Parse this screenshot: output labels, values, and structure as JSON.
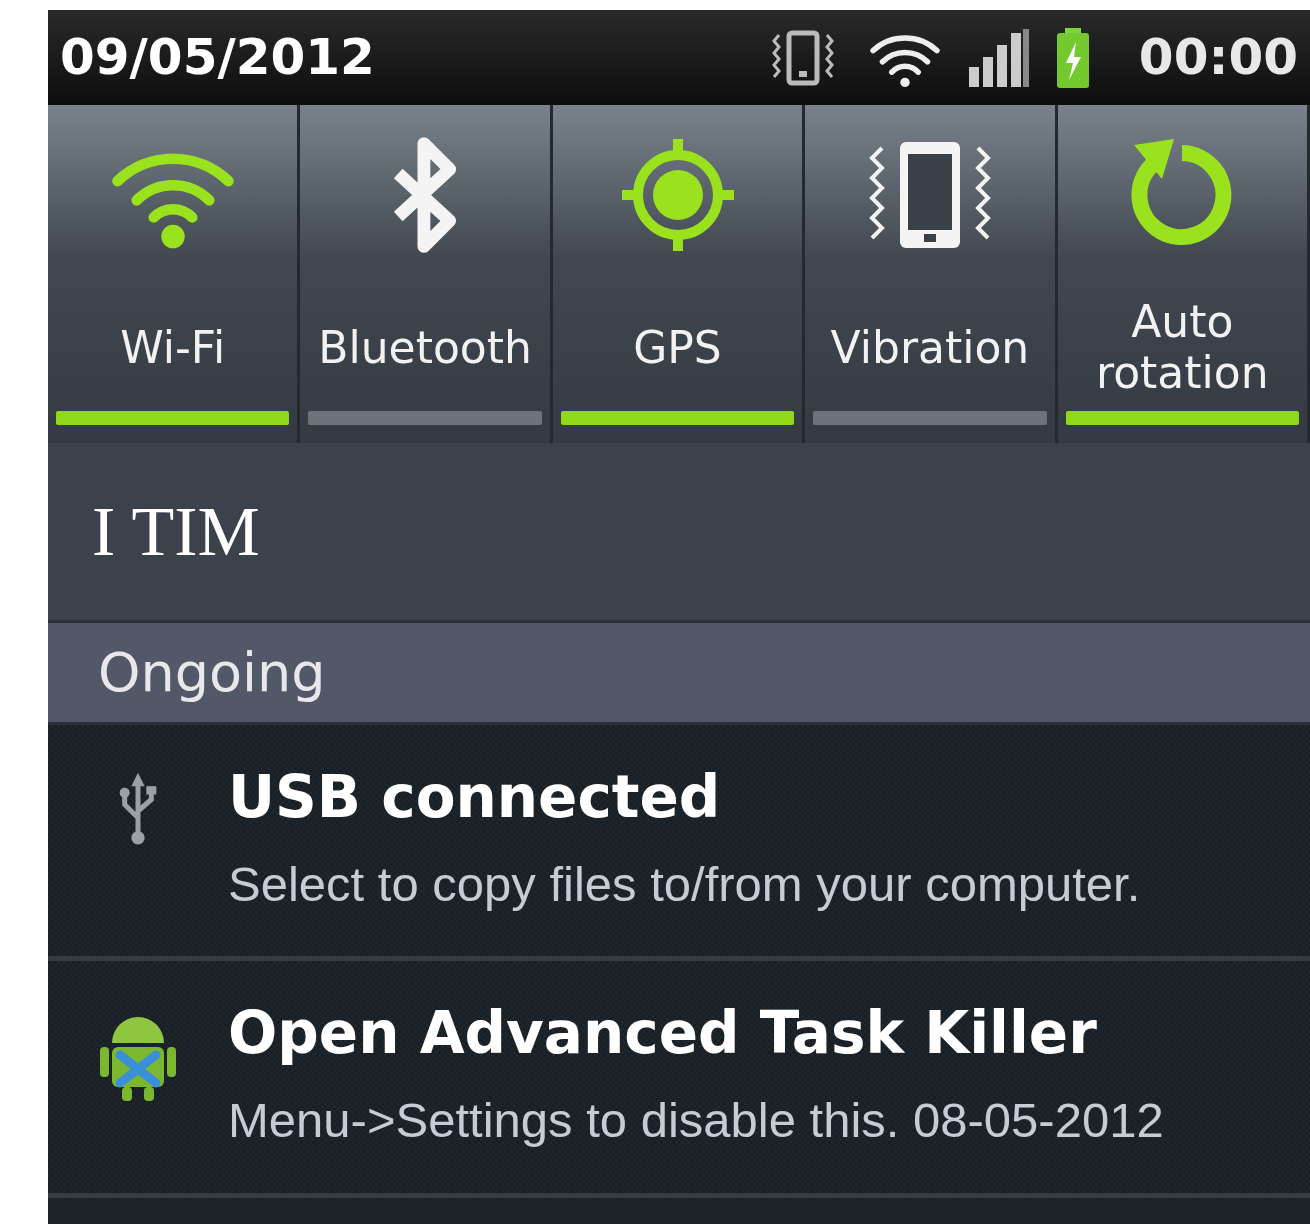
{
  "status_bar": {
    "date": "09/05/2012",
    "time": "00:00"
  },
  "toggles": [
    {
      "kind": "wifi",
      "label": "Wi-Fi",
      "on": true
    },
    {
      "kind": "bluetooth",
      "label": "Bluetooth",
      "on": false
    },
    {
      "kind": "gps",
      "label": "GPS",
      "on": true
    },
    {
      "kind": "vibration",
      "label": "Vibration",
      "on": false
    },
    {
      "kind": "rotation",
      "label": "Auto rotation",
      "on": true
    }
  ],
  "carrier": "I TIM",
  "section": "Ongoing",
  "notifications": [
    {
      "kind": "usb",
      "title": "USB connected",
      "text": "Select to copy files to/from your computer."
    },
    {
      "kind": "app",
      "title": "Open Advanced Task Killer",
      "text": "Menu->Settings to disable this. 08-05-2012"
    }
  ]
}
